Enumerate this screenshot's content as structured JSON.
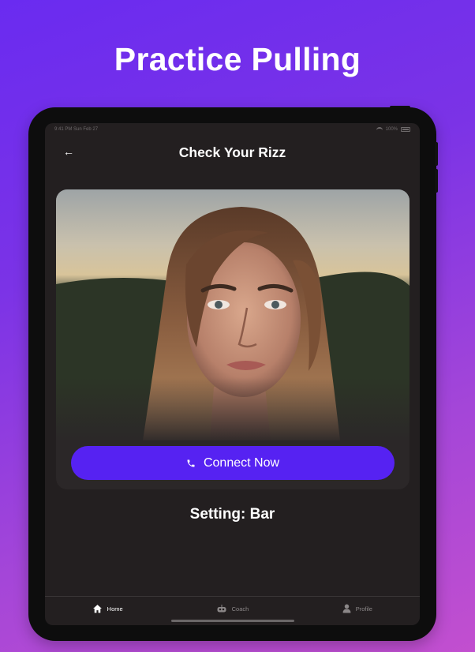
{
  "headline": "Practice Pulling",
  "status_bar": {
    "time": "9:41 PM   Sun Feb 27",
    "battery": "100%"
  },
  "screen": {
    "title": "Check Your Rizz",
    "back_icon": "arrow-left-icon",
    "card": {
      "photo": "portrait-of-woman-outdoors",
      "connect_label": "Connect Now",
      "connect_icon": "phone-icon"
    },
    "setting_text": "Setting: Bar"
  },
  "tabbar": {
    "items": [
      {
        "label": "Home",
        "icon": "home-icon",
        "active": true
      },
      {
        "label": "Coach",
        "icon": "robot-icon",
        "active": false
      },
      {
        "label": "Profile",
        "icon": "person-icon",
        "active": false
      }
    ]
  },
  "colors": {
    "background_gradient_start": "#6a2bf0",
    "background_gradient_end": "#c24fcf",
    "screen_bg": "#231f20",
    "accent": "#5622f2"
  }
}
